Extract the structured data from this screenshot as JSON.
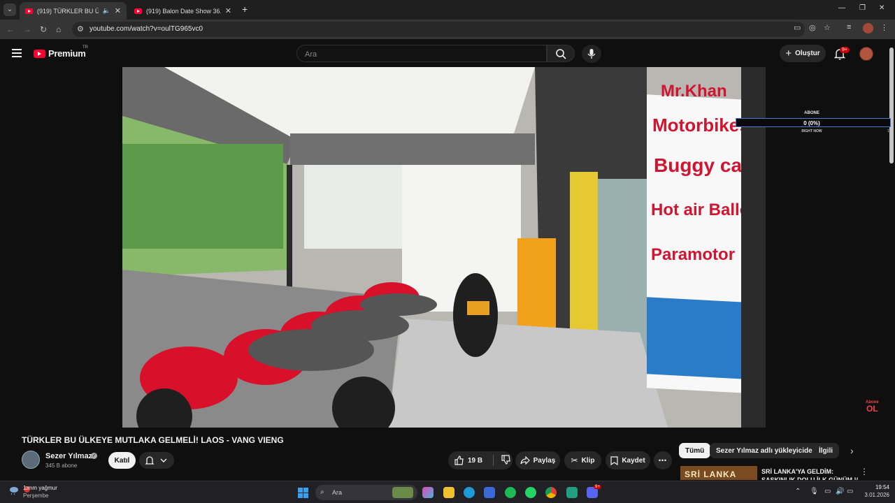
{
  "browser": {
    "tabs": [
      {
        "title": "(919) TÜRKLER BU ÜLKEYE MUTLAKA GELMELİ! LAOS - VANG VIENG",
        "active": true
      },
      {
        "title": "(919) Balon Date Show 36. Bölüm",
        "active": false
      }
    ],
    "url": "youtube.com/watch?v=oulTG965vc0"
  },
  "youtube": {
    "logo_text": "Premium",
    "country_code": "TR",
    "search_placeholder": "Ara",
    "create_label": "Oluştur",
    "notification_badge": "9+"
  },
  "video": {
    "overlay": {
      "label": "ABONE",
      "value": "0 (0%)",
      "subtext": "RIGHT NOW",
      "side_number": "10"
    },
    "watermark_line1": "Abone",
    "watermark_line2": "OL",
    "sign_lines": [
      "Mr.Khan",
      "Motorbikes",
      "Buggy cars",
      "Hot air Balloon",
      "Paramotor"
    ],
    "title": "TÜRKLER BU ÜLKEYE MUTLAKA GELMELİ! LAOS - VANG VIENG"
  },
  "channel": {
    "name": "Sezer Yılmaz",
    "subscribers": "345 B abone",
    "join_label": "Katıl"
  },
  "actions": {
    "likes": "19 B",
    "share": "Paylaş",
    "clip": "Klip",
    "save": "Kaydet"
  },
  "chips": [
    "Tümü",
    "Sezer Yılmaz adlı yükleyiciden",
    "İlgili"
  ],
  "recommendation": {
    "title": "SRİ LANKA'YA GELDİM: ŞAŞKINLIK DOLU İLK GÜNÜM !/ ...",
    "thumb_text": "SRİ LANKA"
  },
  "taskbar": {
    "weather_line1": "1 mm yağmur",
    "weather_line2": "Perşembe",
    "weather_badge": "2",
    "search_label": "Ara",
    "time": "19:54",
    "date": "3.01.2026",
    "discord_badge": "9+"
  },
  "colors": {
    "youtube_red": "#ff0033",
    "background": "#0f0f0f",
    "chip_bg": "#272727",
    "overlay_border": "#4b7bd4"
  }
}
